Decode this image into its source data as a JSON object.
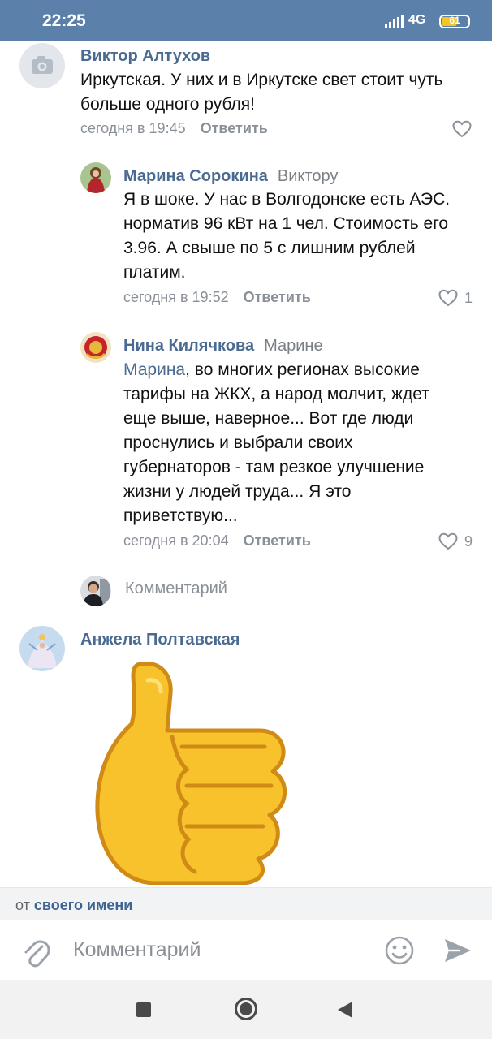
{
  "status_bar": {
    "time": "22:25",
    "network": "4G",
    "battery": "61",
    "battery_fraction": 0.61
  },
  "comments": [
    {
      "author": "Виктор Алтухов",
      "reply_to": "",
      "mention": "",
      "text": "Иркутская. У них и в Иркутске свет стоит чуть больше одного рубля!",
      "time": "сегодня в 19:45",
      "reply_label": "Ответить",
      "likes": ""
    },
    {
      "author": "Марина Сорокина",
      "reply_to": "Виктору",
      "mention": "",
      "text": "Я в шоке. У нас в Волгодонске есть АЭС. норматив 96 кВт на 1 чел. Стоимость его 3.96. А свыше по 5 с лишним рублей платим.",
      "time": "сегодня в 19:52",
      "reply_label": "Ответить",
      "likes": "1"
    },
    {
      "author": "Нина Килячкова",
      "reply_to": "Марине",
      "mention": "Марина",
      "text": ", во многих регионах высокие тарифы на ЖКХ, а народ молчит, ждет еще выше, наверное... Вот где люди проснулись и выбрали своих губернаторов - там резкое улучшение жизни у людей труда... Я это приветствую...",
      "time": "сегодня в 20:04",
      "reply_label": "Ответить",
      "likes": "9"
    }
  ],
  "inline_comment_placeholder": "Комментарий",
  "sticker_post": {
    "author": "Анжела Полтавская",
    "sticker": "thumbs-up"
  },
  "from_bar": {
    "prefix": "от",
    "link": "своего имени"
  },
  "composer": {
    "placeholder": "Комментарий"
  },
  "colors": {
    "header": "#5b81aa",
    "link": "#4a6a91",
    "meta": "#8a9099",
    "sticker": "#f7c22c"
  }
}
